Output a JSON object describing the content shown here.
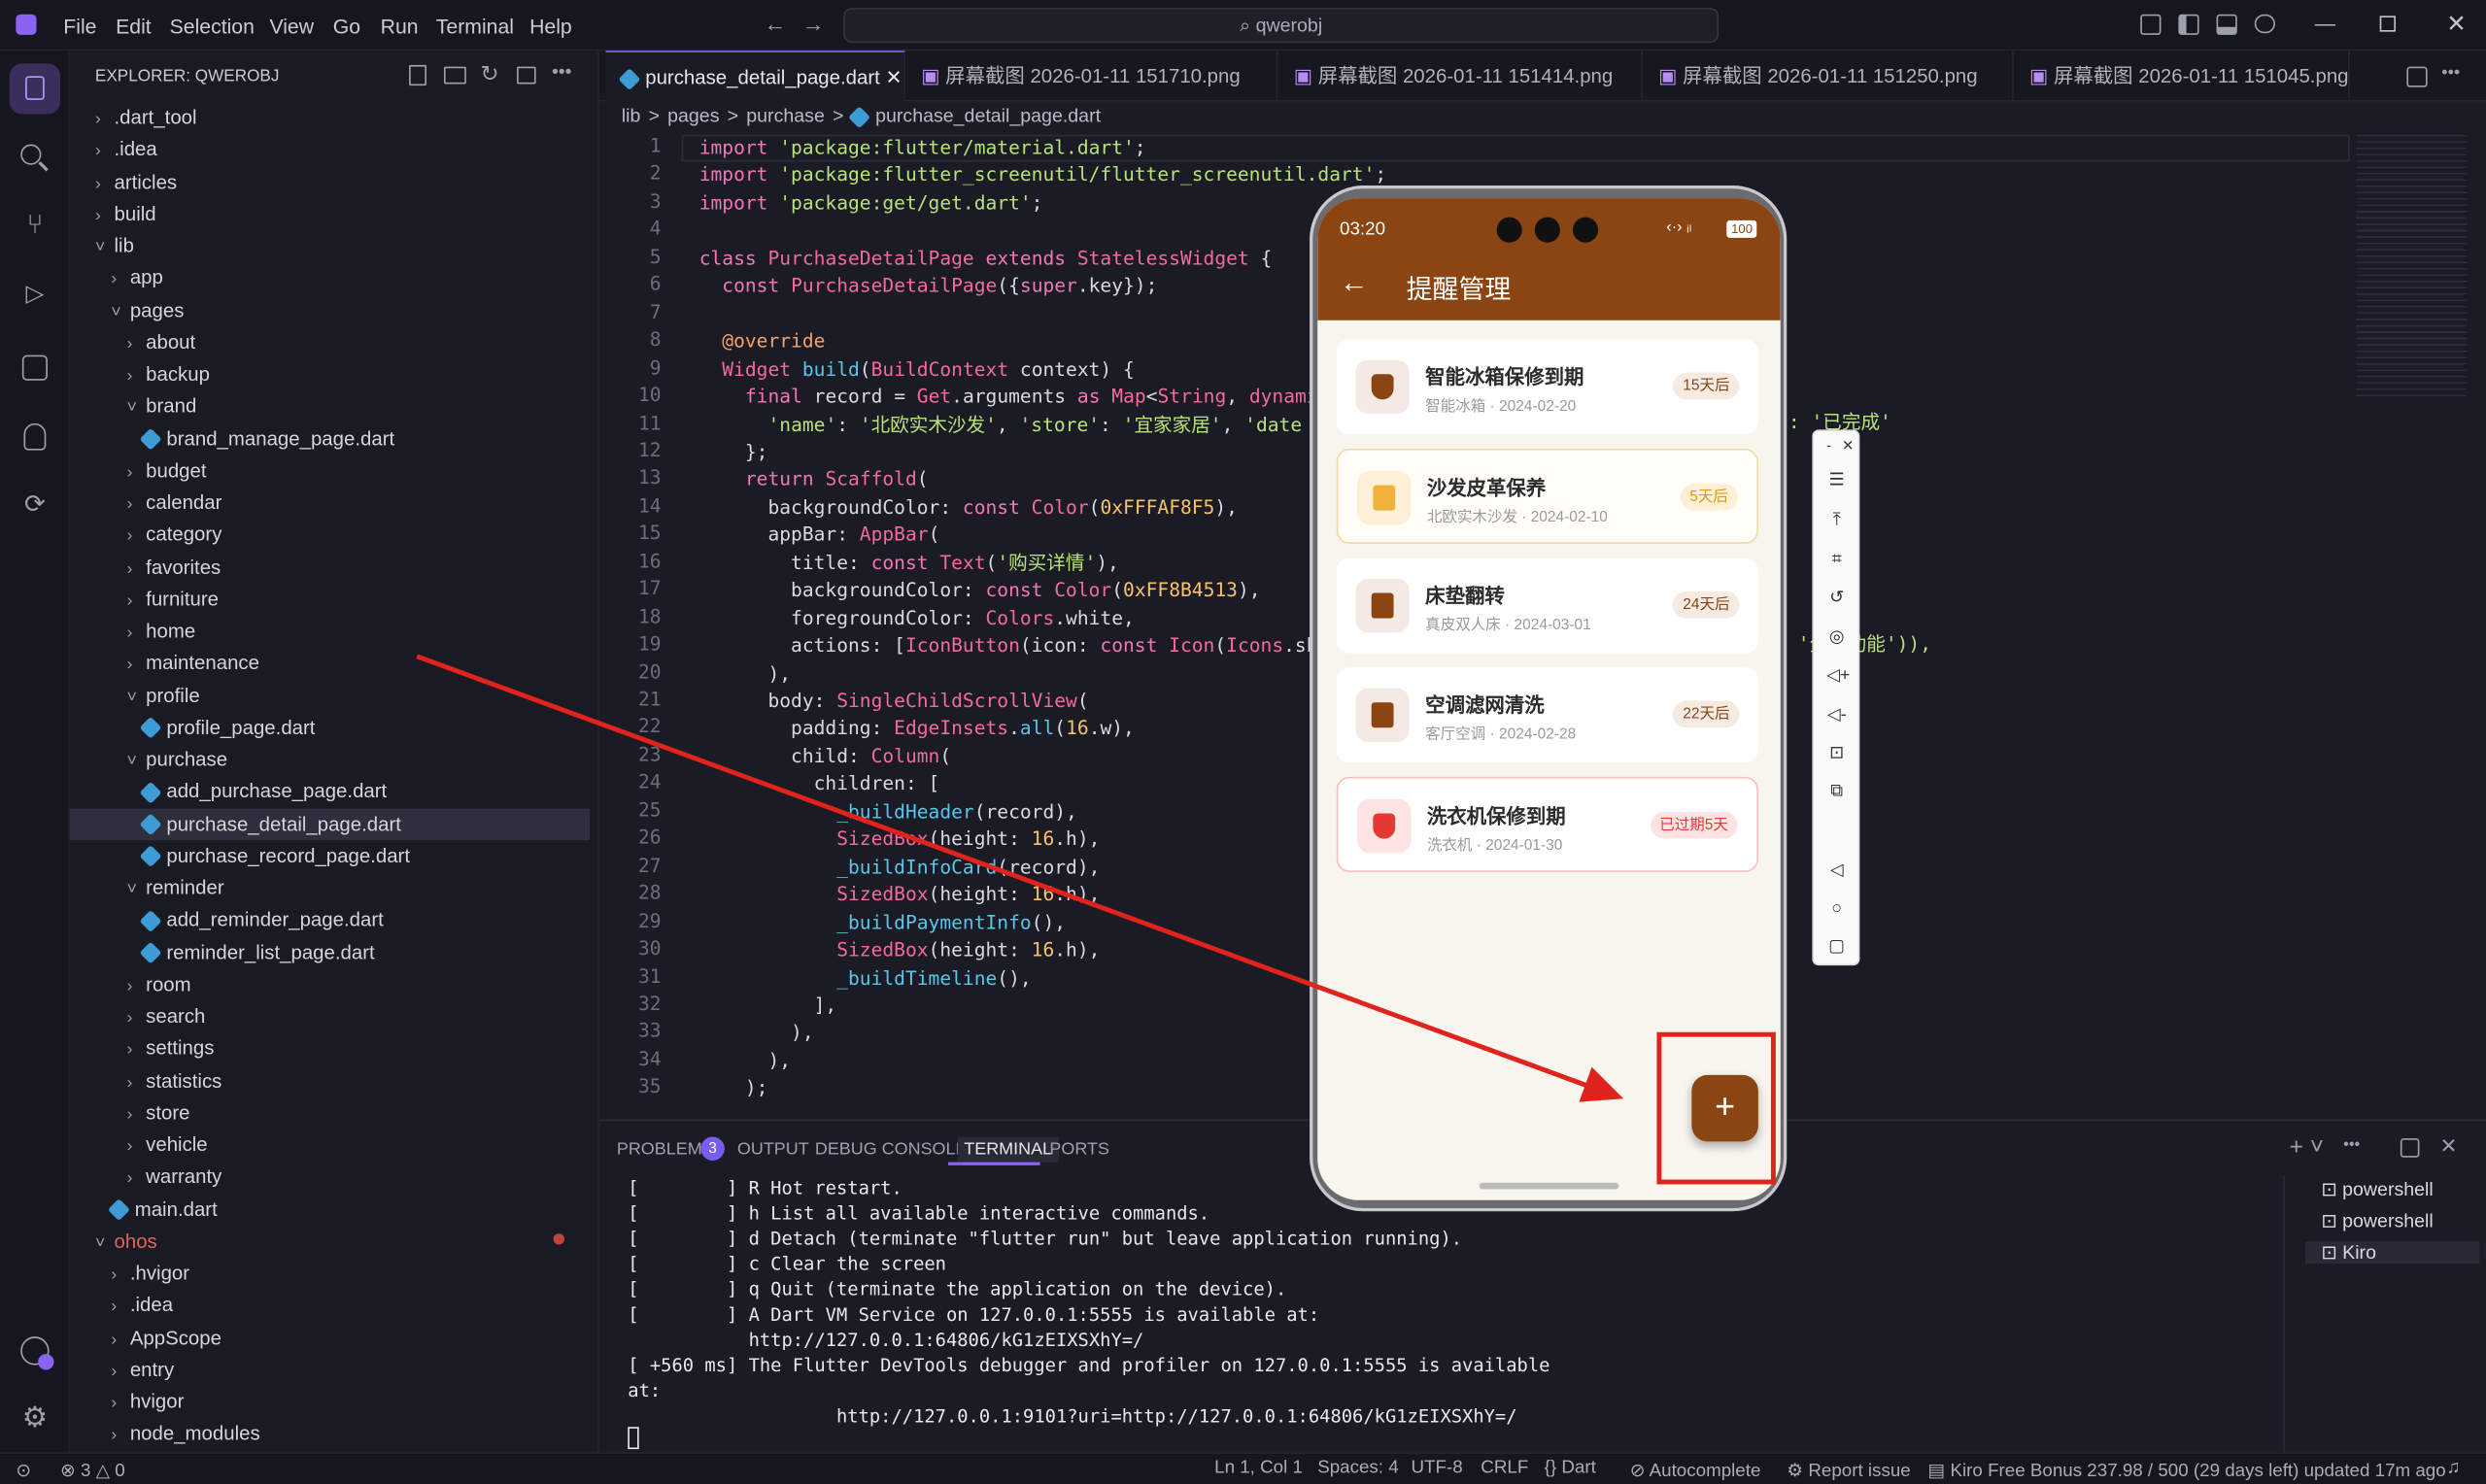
{
  "menu": [
    "File",
    "Edit",
    "Selection",
    "View",
    "Go",
    "Run",
    "Terminal",
    "Help"
  ],
  "search": "qwerobj",
  "explorer": {
    "title": "EXPLORER: QWEROBJ",
    "items": [
      {
        "label": ".dart_tool",
        "d": 0,
        "t": "c"
      },
      {
        "label": ".idea",
        "d": 0,
        "t": "c"
      },
      {
        "label": "articles",
        "d": 0,
        "t": "c"
      },
      {
        "label": "build",
        "d": 0,
        "t": "c"
      },
      {
        "label": "lib",
        "d": 0,
        "t": "o"
      },
      {
        "label": "app",
        "d": 1,
        "t": "c"
      },
      {
        "label": "pages",
        "d": 1,
        "t": "o"
      },
      {
        "label": "about",
        "d": 2,
        "t": "c"
      },
      {
        "label": "backup",
        "d": 2,
        "t": "c"
      },
      {
        "label": "brand",
        "d": 2,
        "t": "o"
      },
      {
        "label": "brand_manage_page.dart",
        "d": 3,
        "t": "f"
      },
      {
        "label": "budget",
        "d": 2,
        "t": "c"
      },
      {
        "label": "calendar",
        "d": 2,
        "t": "c"
      },
      {
        "label": "category",
        "d": 2,
        "t": "c"
      },
      {
        "label": "favorites",
        "d": 2,
        "t": "c"
      },
      {
        "label": "furniture",
        "d": 2,
        "t": "c"
      },
      {
        "label": "home",
        "d": 2,
        "t": "c"
      },
      {
        "label": "maintenance",
        "d": 2,
        "t": "c"
      },
      {
        "label": "profile",
        "d": 2,
        "t": "o"
      },
      {
        "label": "profile_page.dart",
        "d": 3,
        "t": "f"
      },
      {
        "label": "purchase",
        "d": 2,
        "t": "o"
      },
      {
        "label": "add_purchase_page.dart",
        "d": 3,
        "t": "f"
      },
      {
        "label": "purchase_detail_page.dart",
        "d": 3,
        "t": "f",
        "sel": true
      },
      {
        "label": "purchase_record_page.dart",
        "d": 3,
        "t": "f"
      },
      {
        "label": "reminder",
        "d": 2,
        "t": "o"
      },
      {
        "label": "add_reminder_page.dart",
        "d": 3,
        "t": "f"
      },
      {
        "label": "reminder_list_page.dart",
        "d": 3,
        "t": "f"
      },
      {
        "label": "room",
        "d": 2,
        "t": "c"
      },
      {
        "label": "search",
        "d": 2,
        "t": "c"
      },
      {
        "label": "settings",
        "d": 2,
        "t": "c"
      },
      {
        "label": "statistics",
        "d": 2,
        "t": "c"
      },
      {
        "label": "store",
        "d": 2,
        "t": "c"
      },
      {
        "label": "vehicle",
        "d": 2,
        "t": "c"
      },
      {
        "label": "warranty",
        "d": 2,
        "t": "c"
      },
      {
        "label": "main.dart",
        "d": 1,
        "t": "f"
      },
      {
        "label": "ohos",
        "d": 0,
        "t": "o",
        "red": true
      },
      {
        "label": ".hvigor",
        "d": 1,
        "t": "c"
      },
      {
        "label": ".idea",
        "d": 1,
        "t": "c"
      },
      {
        "label": "AppScope",
        "d": 1,
        "t": "c"
      },
      {
        "label": "entry",
        "d": 1,
        "t": "c"
      },
      {
        "label": "hvigor",
        "d": 1,
        "t": "c"
      },
      {
        "label": "node_modules",
        "d": 1,
        "t": "c"
      }
    ]
  },
  "tabs": [
    "purchase_detail_page.dart",
    "屏幕截图 2026-01-11 151710.png",
    "屏幕截图 2026-01-11 151414.png",
    "屏幕截图 2026-01-11 151250.png",
    "屏幕截图 2026-01-11 151045.png"
  ],
  "breadcrumb": [
    "lib",
    ">",
    "pages",
    ">",
    "purchase",
    ">",
    "purchase_detail_page.dart"
  ],
  "code": [
    [
      [
        "kw",
        "import "
      ],
      [
        "str",
        "'package:flutter/material.dart'"
      ],
      [
        "pl",
        ";"
      ]
    ],
    [
      [
        "kw",
        "import "
      ],
      [
        "str",
        "'package:flutter_screenutil/flutter_screenutil.dart'"
      ],
      [
        "pl",
        ";"
      ]
    ],
    [
      [
        "kw",
        "import "
      ],
      [
        "str",
        "'package:get/get.dart'"
      ],
      [
        "pl",
        ";"
      ]
    ],
    [],
    [
      [
        "kw",
        "class "
      ],
      [
        "ty",
        "PurchaseDetailPage "
      ],
      [
        "kw",
        "extends "
      ],
      [
        "ty",
        "StatelessWidget "
      ],
      [
        "pl",
        "{"
      ]
    ],
    [
      [
        "pl",
        "  "
      ],
      [
        "kw",
        "const "
      ],
      [
        "ty",
        "PurchaseDetailPage"
      ],
      [
        "pl",
        "({"
      ],
      [
        "kw",
        "super"
      ],
      [
        "pl",
        ".key});"
      ]
    ],
    [],
    [
      [
        "pl",
        "  "
      ],
      [
        "an",
        "@override"
      ]
    ],
    [
      [
        "pl",
        "  "
      ],
      [
        "ty",
        "Widget "
      ],
      [
        "fn",
        "build"
      ],
      [
        "pl",
        "("
      ],
      [
        "ty",
        "BuildContext "
      ],
      [
        "pl",
        "context) {"
      ]
    ],
    [
      [
        "pl",
        "    "
      ],
      [
        "kw",
        "final "
      ],
      [
        "pl",
        "record = "
      ],
      [
        "ty",
        "Get"
      ],
      [
        "pl",
        ".arguments "
      ],
      [
        "kw",
        "as "
      ],
      [
        "ty",
        "Map"
      ],
      [
        "pl",
        "<"
      ],
      [
        "ty",
        "String"
      ],
      [
        "pl",
        ", "
      ],
      [
        "ty",
        "dynamic"
      ]
    ],
    [
      [
        "pl",
        "      "
      ],
      [
        "str",
        "'name'"
      ],
      [
        "pl",
        ": "
      ],
      [
        "str",
        "'北欧实木沙发'"
      ],
      [
        "pl",
        ", "
      ],
      [
        "str",
        "'store'"
      ],
      [
        "pl",
        ": "
      ],
      [
        "str",
        "'宜家家居'"
      ],
      [
        "pl",
        ", "
      ],
      [
        "str",
        "'date"
      ]
    ],
    [
      [
        "pl",
        "    };"
      ]
    ],
    [
      [
        "pl",
        "    "
      ],
      [
        "kw",
        "return "
      ],
      [
        "ty",
        "Scaffold"
      ],
      [
        "pl",
        "("
      ]
    ],
    [
      [
        "pl",
        "      backgroundColor: "
      ],
      [
        "kw",
        "const "
      ],
      [
        "ty",
        "Color"
      ],
      [
        "pl",
        "("
      ],
      [
        "nu",
        "0xFFFAF8F5"
      ],
      [
        "pl",
        "),"
      ]
    ],
    [
      [
        "pl",
        "      appBar: "
      ],
      [
        "ty",
        "AppBar"
      ],
      [
        "pl",
        "("
      ]
    ],
    [
      [
        "pl",
        "        title: "
      ],
      [
        "kw",
        "const "
      ],
      [
        "ty",
        "Text"
      ],
      [
        "pl",
        "("
      ],
      [
        "str",
        "'购买详情'"
      ],
      [
        "pl",
        "),"
      ]
    ],
    [
      [
        "pl",
        "        backgroundColor: "
      ],
      [
        "kw",
        "const "
      ],
      [
        "ty",
        "Color"
      ],
      [
        "pl",
        "("
      ],
      [
        "nu",
        "0xFF8B4513"
      ],
      [
        "pl",
        "),"
      ]
    ],
    [
      [
        "pl",
        "        foregroundColor: "
      ],
      [
        "ty",
        "Colors"
      ],
      [
        "pl",
        ".white,"
      ]
    ],
    [
      [
        "pl",
        "        actions: ["
      ],
      [
        "ty",
        "IconButton"
      ],
      [
        "pl",
        "(icon: "
      ],
      [
        "kw",
        "const "
      ],
      [
        "ty",
        "Icon"
      ],
      [
        "pl",
        "("
      ],
      [
        "ty",
        "Icons"
      ],
      [
        "pl",
        ".sha"
      ]
    ],
    [
      [
        "pl",
        "      ),"
      ]
    ],
    [
      [
        "pl",
        "      body: "
      ],
      [
        "ty",
        "SingleChildScrollView"
      ],
      [
        "pl",
        "("
      ]
    ],
    [
      [
        "pl",
        "        padding: "
      ],
      [
        "ty",
        "EdgeInsets"
      ],
      [
        "pl",
        "."
      ],
      [
        "fn",
        "all"
      ],
      [
        "pl",
        "("
      ],
      [
        "nu",
        "16"
      ],
      [
        "pl",
        ".w),"
      ]
    ],
    [
      [
        "pl",
        "        child: "
      ],
      [
        "ty",
        "Column"
      ],
      [
        "pl",
        "("
      ]
    ],
    [
      [
        "pl",
        "          children: ["
      ]
    ],
    [
      [
        "pl",
        "            "
      ],
      [
        "fn",
        "_buildHeader"
      ],
      [
        "pl",
        "(record),"
      ]
    ],
    [
      [
        "pl",
        "            "
      ],
      [
        "ty",
        "SizedBox"
      ],
      [
        "pl",
        "(height: "
      ],
      [
        "nu",
        "16"
      ],
      [
        "pl",
        ".h),"
      ]
    ],
    [
      [
        "pl",
        "            "
      ],
      [
        "fn",
        "_buildInfoCard"
      ],
      [
        "pl",
        "(record),"
      ]
    ],
    [
      [
        "pl",
        "            "
      ],
      [
        "ty",
        "SizedBox"
      ],
      [
        "pl",
        "(height: "
      ],
      [
        "nu",
        "16"
      ],
      [
        "pl",
        ".h),"
      ]
    ],
    [
      [
        "pl",
        "            "
      ],
      [
        "fn",
        "_buildPaymentInfo"
      ],
      [
        "pl",
        "(),"
      ]
    ],
    [
      [
        "pl",
        "            "
      ],
      [
        "ty",
        "SizedBox"
      ],
      [
        "pl",
        "(height: "
      ],
      [
        "nu",
        "16"
      ],
      [
        "pl",
        ".h),"
      ]
    ],
    [
      [
        "pl",
        "            "
      ],
      [
        "fn",
        "_buildTimeline"
      ],
      [
        "pl",
        "(),"
      ]
    ],
    [
      [
        "pl",
        "          ],"
      ]
    ],
    [
      [
        "pl",
        "        ),"
      ]
    ],
    [
      [
        "pl",
        "      ),"
      ]
    ],
    [
      [
        "pl",
        "    );"
      ]
    ]
  ],
  "code_right": {
    "line11": ": '已完成'",
    "line19": "'分享功能')),"
  },
  "panel": {
    "tabs": [
      "PROBLEMS",
      "OUTPUT",
      "DEBUG CONSOLE",
      "TERMINAL",
      "PORTS"
    ],
    "problems_count": "3",
    "terminal": [
      "[        ] R Hot restart.",
      "[        ] h List all available interactive commands.",
      "[        ] d Detach (terminate \"flutter run\" but leave application running).",
      "[        ] c Clear the screen",
      "[        ] q Quit (terminate the application on the device).",
      "[        ] A Dart VM Service on 127.0.0.1:5555 is available at:",
      "           http://127.0.0.1:64806/kG1zEIXSXhY=/",
      "[ +560 ms] The Flutter DevTools debugger and profiler on 127.0.0.1:5555 is available",
      "at:",
      "                   http://127.0.0.1:9101?uri=http://127.0.0.1:64806/kG1zEIXSXhY=/"
    ],
    "shells": [
      "powershell",
      "powershell",
      "Kiro"
    ]
  },
  "status": {
    "errors": "3",
    "warnings": "0",
    "position": "Ln 1, Col 1",
    "spaces": "Spaces: 4",
    "encoding": "UTF-8",
    "eol": "CRLF",
    "lang": "Dart",
    "autocomplete": "Autocomplete",
    "report": "Report issue",
    "kiro": "Kiro Free Bonus 237.98 / 500 (29 days left) updated 17m ago"
  },
  "phone": {
    "time": "03:20",
    "battery": "100",
    "title": "提醒管理",
    "fab": "+",
    "accent": "#8B4513",
    "reminders": [
      {
        "title": "智能冰箱保修到期",
        "sub": "智能冰箱 · 2024-02-20",
        "badge": "15天后",
        "icon": "shield-icon",
        "state": "normal"
      },
      {
        "title": "沙发皮革保养",
        "sub": "北欧实木沙发 · 2024-02-10",
        "badge": "5天后",
        "icon": "cleaning-icon",
        "state": "soon"
      },
      {
        "title": "床垫翻转",
        "sub": "真皮双人床 · 2024-03-01",
        "badge": "24天后",
        "icon": "cleaning-icon",
        "state": "normal"
      },
      {
        "title": "空调滤网清洗",
        "sub": "客厅空调 · 2024-02-28",
        "badge": "22天后",
        "icon": "cleaning-icon",
        "state": "normal"
      },
      {
        "title": "洗衣机保修到期",
        "sub": "洗衣机 · 2024-01-30",
        "badge": "已过期5天",
        "icon": "shield-icon",
        "state": "overdue"
      }
    ]
  }
}
